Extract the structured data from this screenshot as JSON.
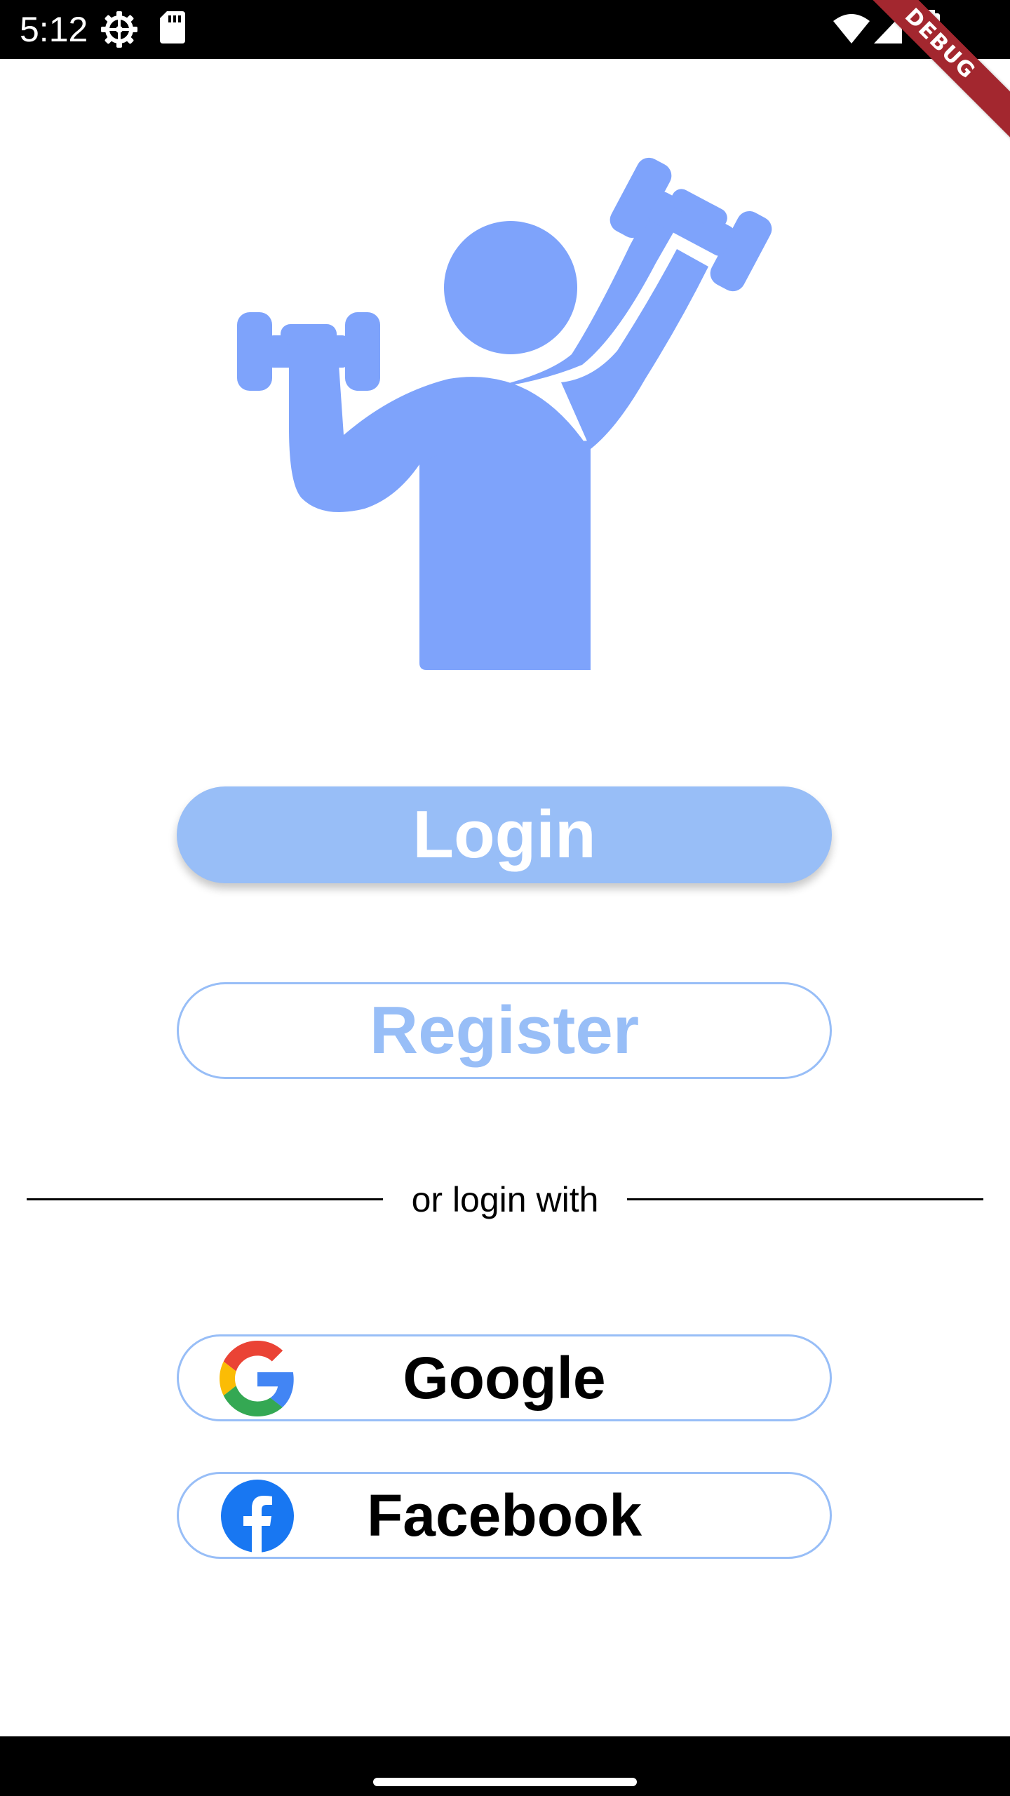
{
  "status_bar": {
    "time": "5:12",
    "left_icons": [
      "settings-gear-icon",
      "sd-card-icon"
    ],
    "right_icons": [
      "wifi-icon",
      "cellular-signal-icon",
      "battery-icon"
    ],
    "debug_banner": "DEBUG"
  },
  "logo": {
    "icon": "weightlifter-icon",
    "color": "#7ea3fb"
  },
  "buttons": {
    "login_label": "Login",
    "register_label": "Register"
  },
  "divider": {
    "text": "or login with"
  },
  "social": {
    "google_label": "Google",
    "facebook_label": "Facebook"
  },
  "colors": {
    "accent": "#98bef7",
    "logo": "#7ea3fb",
    "facebook": "#1877f2"
  }
}
